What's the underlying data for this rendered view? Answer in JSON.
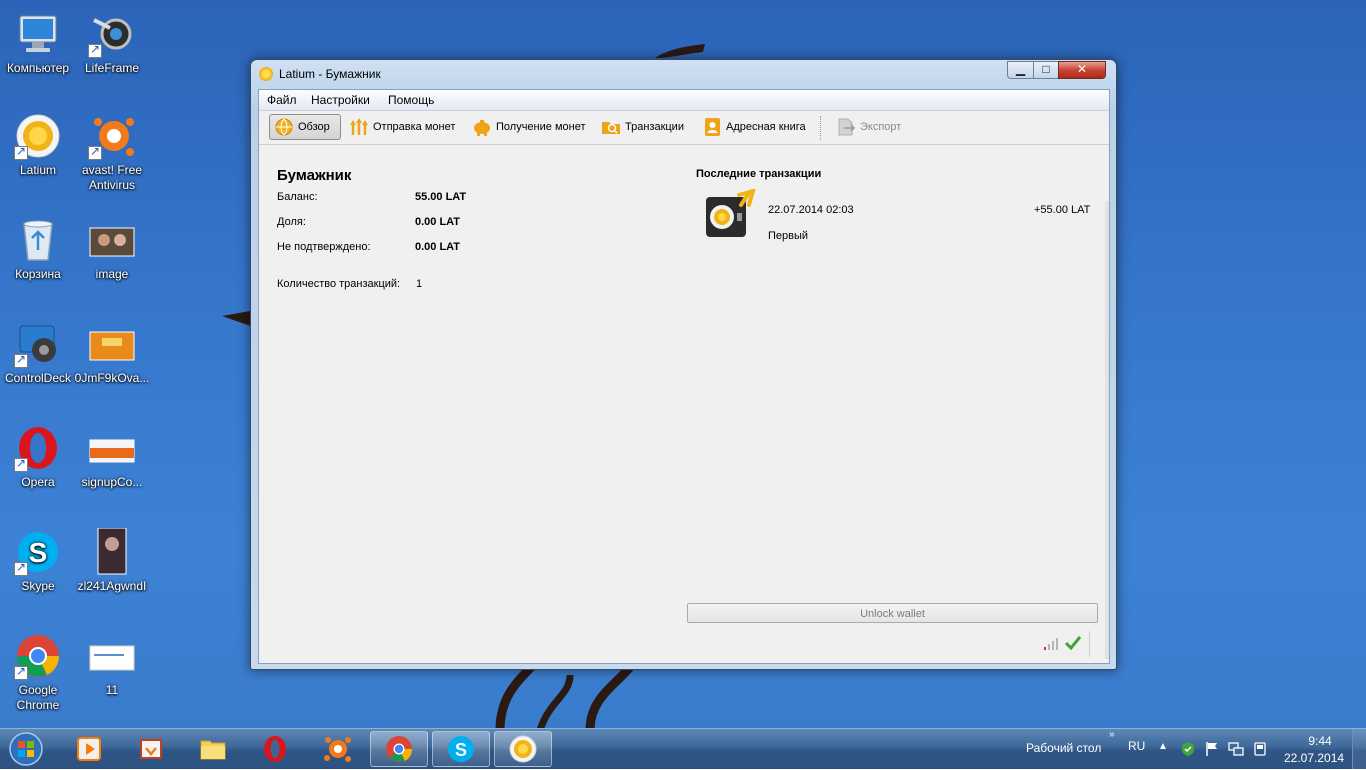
{
  "desktop": {
    "icons": [
      {
        "label": "Компьютер"
      },
      {
        "label": "LifeFrame"
      },
      {
        "label": "Latium"
      },
      {
        "label": "avast! Free Antivirus"
      },
      {
        "label": "Корзина"
      },
      {
        "label": "image"
      },
      {
        "label": "ControlDeck"
      },
      {
        "label": "0JmF9kOva..."
      },
      {
        "label": "Opera"
      },
      {
        "label": "signupCo..."
      },
      {
        "label": "Skype"
      },
      {
        "label": "zl241AgwndI"
      },
      {
        "label": "Google Chrome"
      },
      {
        "label": "11"
      }
    ]
  },
  "window": {
    "title": "Latium - Бумажник",
    "menu": [
      "Файл",
      "Настройки",
      "Помощь"
    ],
    "toolbar": {
      "overview": "Обзор",
      "send": "Отправка монет",
      "receive": "Получение монет",
      "transactions": "Транзакции",
      "addressbook": "Адресная книга",
      "export": "Экспорт"
    },
    "wallet": {
      "title": "Бумажник",
      "balance_label": "Баланс:",
      "balance_value": "55.00 LAT",
      "stake_label": "Доля:",
      "stake_value": "0.00 LAT",
      "unconfirmed_label": "Не подтверждено:",
      "unconfirmed_value": "0.00 LAT",
      "txcount_label": "Количество транзакций:",
      "txcount_value": "1"
    },
    "recent": {
      "title": "Последние транзакции",
      "items": [
        {
          "date": "22.07.2014 02:03",
          "amount": "+55.00 LAT",
          "label": "Первый"
        }
      ]
    },
    "unlock_button": "Unlock wallet"
  },
  "taskbar": {
    "desktop_label": "Рабочий стол",
    "language": "RU",
    "time": "9:44",
    "date": "22.07.2014"
  },
  "colors": {
    "desktop_bg": "#3576cb",
    "taskbar": "#2e5585",
    "close_button": "#c74536"
  }
}
